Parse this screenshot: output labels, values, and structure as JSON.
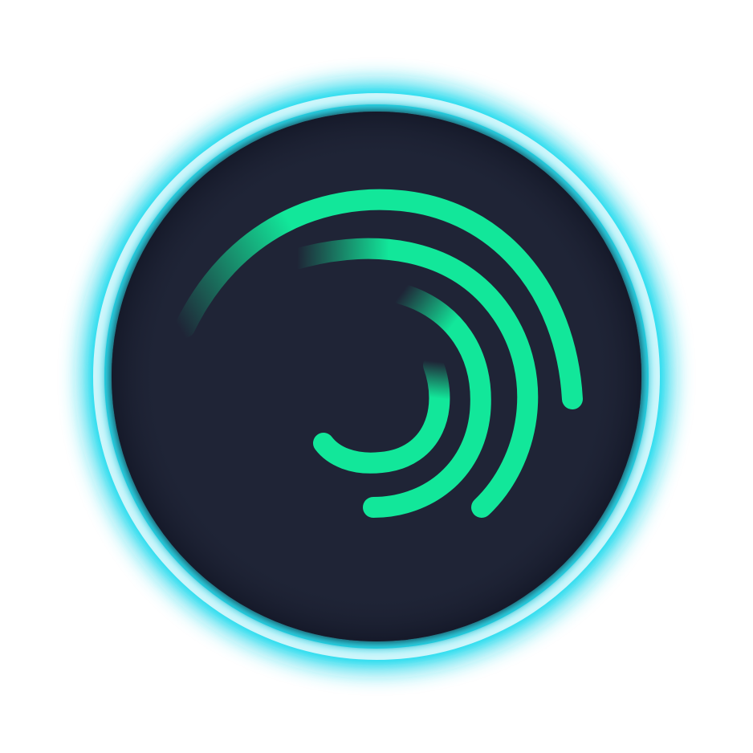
{
  "logo": {
    "icon": "swirl-arcs-icon",
    "colors": {
      "background": "#ffffff",
      "badge_fill": "#1f2436",
      "glow": "#18d6ea",
      "ring": "#cdf6fb",
      "arc": "#12e79a"
    }
  }
}
